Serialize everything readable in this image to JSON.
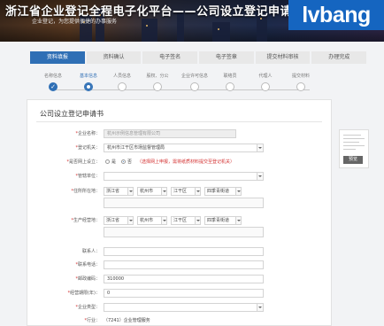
{
  "banner": {
    "title": "浙江省企业登记全程电子化平台——公司设立登记申请（企业开",
    "subtitle": "企业登记，为您提供便捷的办事服务",
    "watermark": "lvbang"
  },
  "steps": [
    "资料填报",
    "资料确认",
    "电子签名",
    "电子签章",
    "提交材料审核",
    "办理完成"
  ],
  "substeps": [
    "名称信息",
    "基本信息",
    "人员信息",
    "股权、分公",
    "企业许可信息",
    "联络员",
    "代理人",
    "提交材料"
  ],
  "form": {
    "title": "公司设立登记申请书",
    "fields": {
      "company_name": {
        "label": "企业名称：",
        "value": "杭州示例信息管理有限公司"
      },
      "registration_authority": {
        "label": "登记机关：",
        "value": "杭州市江干区市场监督管理局"
      },
      "online_branch": {
        "label": "是否网上设立：",
        "option_yes": "是",
        "option_no": "否",
        "hint": "（选择网上申报，需将纸质材料提交至登记机关）"
      },
      "management_unit": {
        "label": "管辖单位：",
        "value": ""
      },
      "domicile": {
        "label": "住所所在地：",
        "province": "浙江省",
        "city": "杭州市",
        "district": "江干区",
        "street": "四季青街道"
      },
      "production_address": {
        "label": "生产经营地：",
        "province": "浙江省",
        "city": "杭州市",
        "district": "江干区",
        "street": "四季青街道"
      },
      "contact_person": {
        "label": "联系人：",
        "value": ""
      },
      "phone": {
        "label": "联系电话：",
        "value": ""
      },
      "postal_code": {
        "label": "邮政编码：",
        "value": "310000"
      },
      "operating_period": {
        "label": "经营期限(年)：",
        "value": "0"
      },
      "company_type": {
        "label": "企业类型：",
        "value": ""
      },
      "industry": {
        "label": "行业：",
        "value": "（7241）企业管理服务"
      }
    }
  },
  "preview": {
    "button": "预览"
  },
  "colors": {
    "accent": "#2f6fb5",
    "required": "#d32f2f",
    "watermark_bg": "#1565c0"
  }
}
